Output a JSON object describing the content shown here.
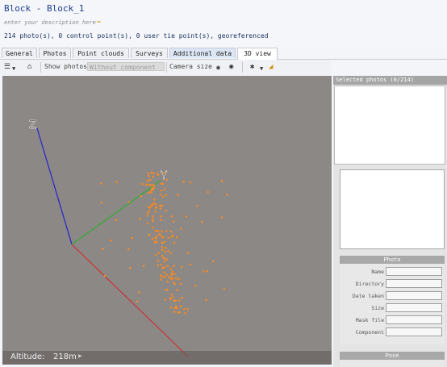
{
  "header": {
    "title": "Block - Block_1",
    "description_placeholder": "enter your description here",
    "summary": "214 photo(s), 0 control point(s), 0 user tie point(s), georeferenced"
  },
  "tabs": [
    {
      "label": "General"
    },
    {
      "label": "Photos"
    },
    {
      "label": "Point clouds"
    },
    {
      "label": "Surveys"
    },
    {
      "label": "Additional data"
    },
    {
      "label": "3D view"
    }
  ],
  "toolbar": {
    "show_photos_label": "Show photos",
    "show_photos_value": "Without component",
    "camera_size_label": "Camera size"
  },
  "viewport": {
    "axis_labels": {
      "x": "",
      "y": "Y",
      "z": "Z"
    },
    "altitude_label": "Altitude:",
    "altitude_value": "218m"
  },
  "right_panel": {
    "selected_header": "Selected photos (0/214)",
    "photo_group_title": "Photo",
    "photo_fields": [
      {
        "label": "Name",
        "value": ""
      },
      {
        "label": "Directory",
        "value": ""
      },
      {
        "label": "Date taken",
        "value": ""
      },
      {
        "label": "Size",
        "value": ""
      },
      {
        "label": "Mask file",
        "value": ""
      },
      {
        "label": "Component",
        "value": ""
      }
    ],
    "pose_group_title": "Pose"
  },
  "colors": {
    "title_text": "#1d3d8c",
    "viewport_bg": "#8c8886",
    "axis_x": "#cc3333",
    "axis_y": "#33aa33",
    "axis_z": "#2222cc",
    "photo_points": "#f08a2a",
    "tab_active_bg": "#ffffff",
    "tab_highlight_bg": "#dce6f5",
    "group_header_bg": "#a8a8a8"
  }
}
